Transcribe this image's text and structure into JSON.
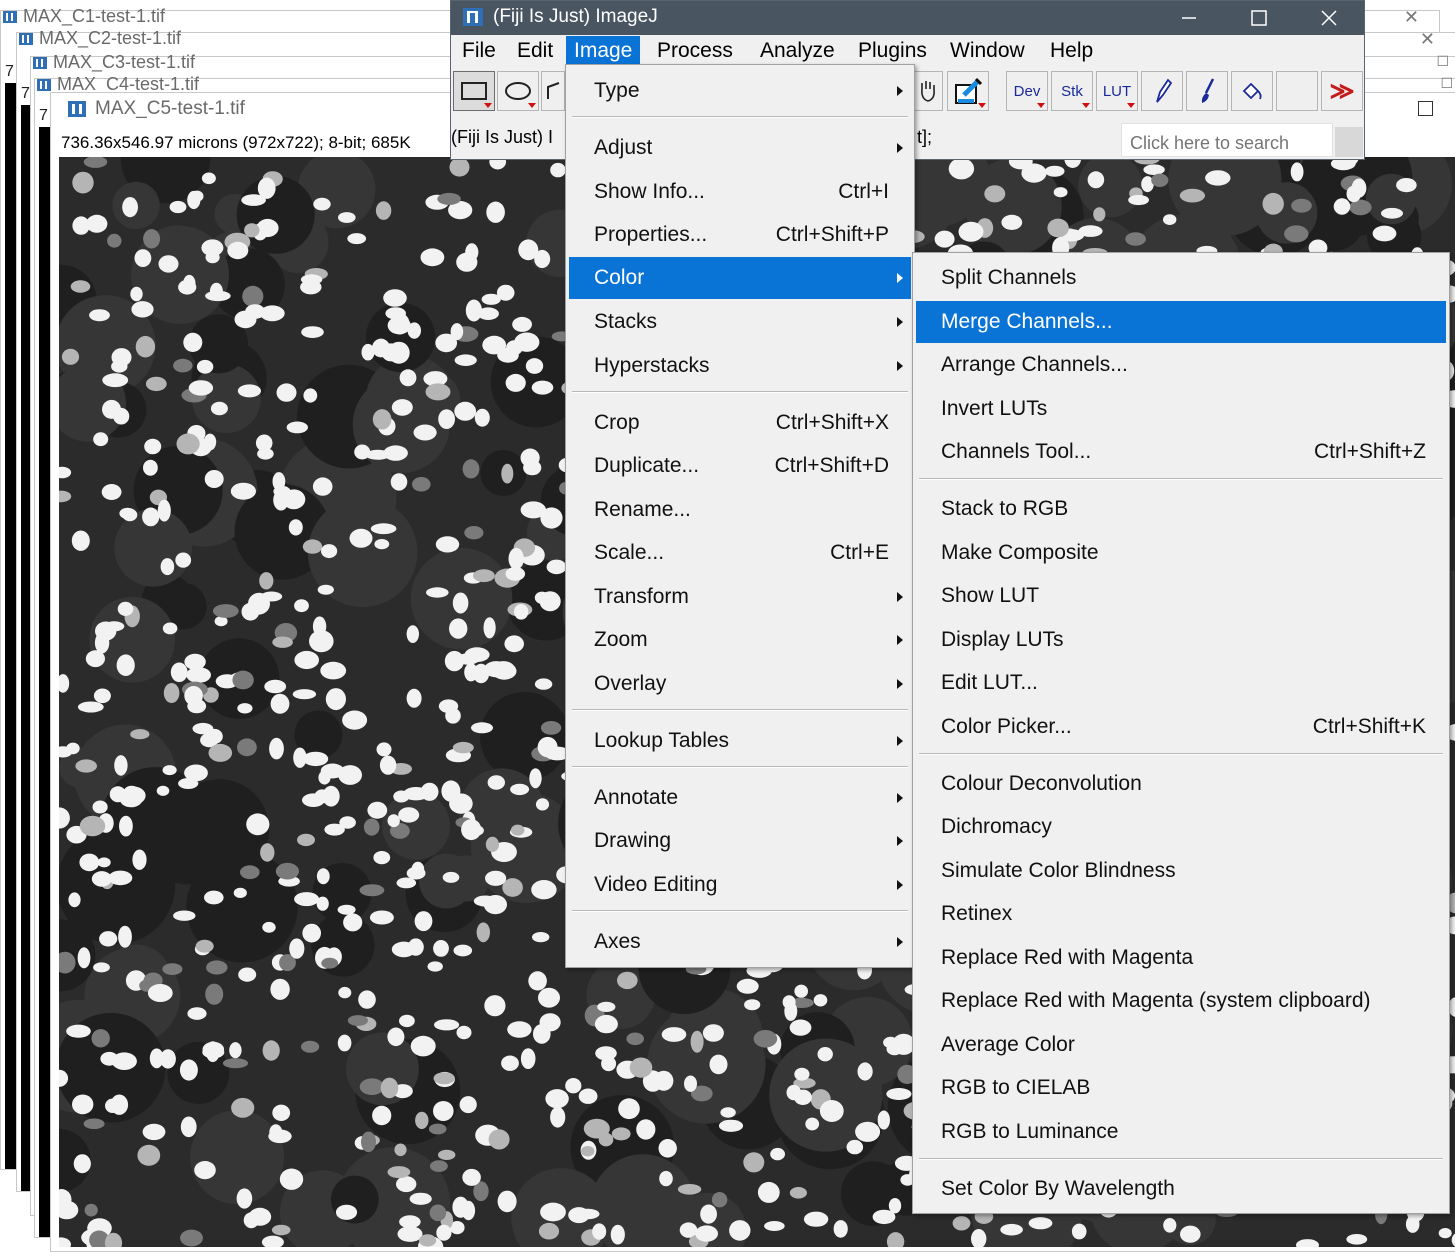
{
  "background_windows": [
    {
      "title": "MAX_C1-test-1.tif",
      "num": "7"
    },
    {
      "title": "MAX_C2-test-1.tif",
      "num": "7"
    },
    {
      "title": "MAX_C3-test-1.tif",
      "num": "7"
    },
    {
      "title": "MAX_C4-test-1.tif",
      "num": "7"
    }
  ],
  "front_window": {
    "title": "MAX_C5-test-1.tif",
    "info": "736.36x546.97 microns (972x722); 8-bit; 685K"
  },
  "imagej": {
    "title": "(Fiji Is Just) ImageJ",
    "menus": [
      "File",
      "Edit",
      "Image",
      "Process",
      "Analyze",
      "Plugins",
      "Window",
      "Help"
    ],
    "active_menu": "Image",
    "status_left": "(Fiji Is Just) I",
    "status_right": "t];",
    "search_placeholder": "Click here to search",
    "toolbar": {
      "dev": "Dev",
      "stk": "Stk",
      "lut": "LUT",
      "more": "≫"
    }
  },
  "image_menu": {
    "items": {
      "type": "Type",
      "adjust": "Adjust",
      "show_info": "Show Info...",
      "show_info_sc": "Ctrl+I",
      "properties": "Properties...",
      "properties_sc": "Ctrl+Shift+P",
      "color": "Color",
      "stacks": "Stacks",
      "hyperstacks": "Hyperstacks",
      "crop": "Crop",
      "crop_sc": "Ctrl+Shift+X",
      "duplicate": "Duplicate...",
      "duplicate_sc": "Ctrl+Shift+D",
      "rename": "Rename...",
      "scale": "Scale...",
      "scale_sc": "Ctrl+E",
      "transform": "Transform",
      "zoom": "Zoom",
      "overlay": "Overlay",
      "lookup_tables": "Lookup Tables",
      "annotate": "Annotate",
      "drawing": "Drawing",
      "video_editing": "Video Editing",
      "axes": "Axes"
    }
  },
  "color_menu": {
    "items": {
      "split_channels": "Split Channels",
      "merge_channels": "Merge Channels...",
      "arrange_channels": "Arrange Channels...",
      "invert_luts": "Invert LUTs",
      "channels_tool": "Channels Tool...",
      "channels_tool_sc": "Ctrl+Shift+Z",
      "stack_to_rgb": "Stack to RGB",
      "make_composite": "Make Composite",
      "show_lut": "Show LUT",
      "display_luts": "Display LUTs",
      "edit_lut": "Edit LUT...",
      "color_picker": "Color Picker...",
      "color_picker_sc": "Ctrl+Shift+K",
      "colour_deconvolution": "Colour Deconvolution",
      "dichromacy": "Dichromacy",
      "simulate_color_blindness": "Simulate Color Blindness",
      "retinex": "Retinex",
      "replace_red_magenta": "Replace Red with Magenta",
      "replace_red_magenta_clip": "Replace Red with Magenta (system clipboard)",
      "average_color": "Average Color",
      "rgb_to_cielab": "RGB to CIELAB",
      "rgb_to_luminance": "RGB to Luminance",
      "set_color_by_wavelength": "Set Color By Wavelength"
    }
  },
  "colors": {
    "highlight": "#0a74d6",
    "titlebar": "#4a5562",
    "menu_bg": "#f0f0f0"
  }
}
